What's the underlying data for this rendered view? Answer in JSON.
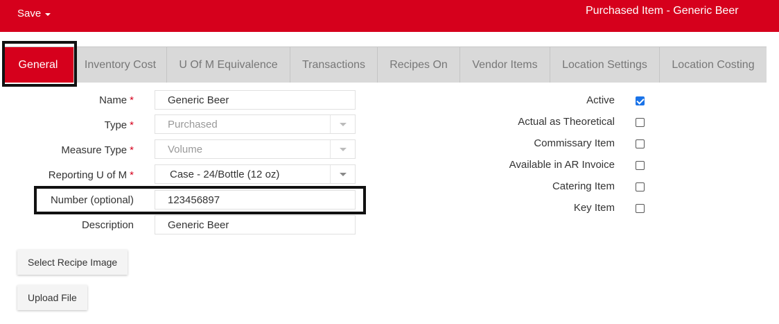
{
  "topbar": {
    "save_label": "Save",
    "title": "Purchased Item - Generic Beer"
  },
  "tabs": [
    {
      "label": "General",
      "active": true
    },
    {
      "label": "Inventory Cost"
    },
    {
      "label": "U Of M Equivalence"
    },
    {
      "label": "Transactions"
    },
    {
      "label": "Recipes On"
    },
    {
      "label": "Vendor Items"
    },
    {
      "label": "Location Settings"
    },
    {
      "label": "Location Costing"
    }
  ],
  "form": {
    "name": {
      "label": "Name",
      "required": "*",
      "value": "Generic Beer"
    },
    "type": {
      "label": "Type",
      "required": "*",
      "value": "Purchased"
    },
    "measure_type": {
      "label": "Measure Type",
      "required": "*",
      "value": "Volume"
    },
    "reporting_uom": {
      "label": "Reporting U of M",
      "required": "*",
      "value": "Case - 24/Bottle (12 oz)"
    },
    "number": {
      "label": "Number (optional)",
      "value": "123456897"
    },
    "description": {
      "label": "Description",
      "value": "Generic Beer"
    }
  },
  "flags": [
    {
      "label": "Active",
      "checked": true
    },
    {
      "label": "Actual as Theoretical",
      "checked": false
    },
    {
      "label": "Commissary Item",
      "checked": false
    },
    {
      "label": "Available in AR Invoice",
      "checked": false
    },
    {
      "label": "Catering Item",
      "checked": false
    },
    {
      "label": "Key Item",
      "checked": false
    }
  ],
  "buttons": {
    "select_image": "Select Recipe Image",
    "upload_file": "Upload File"
  },
  "colors": {
    "brand_red": "#d6001c",
    "checkbox_blue": "#1a73e8"
  }
}
